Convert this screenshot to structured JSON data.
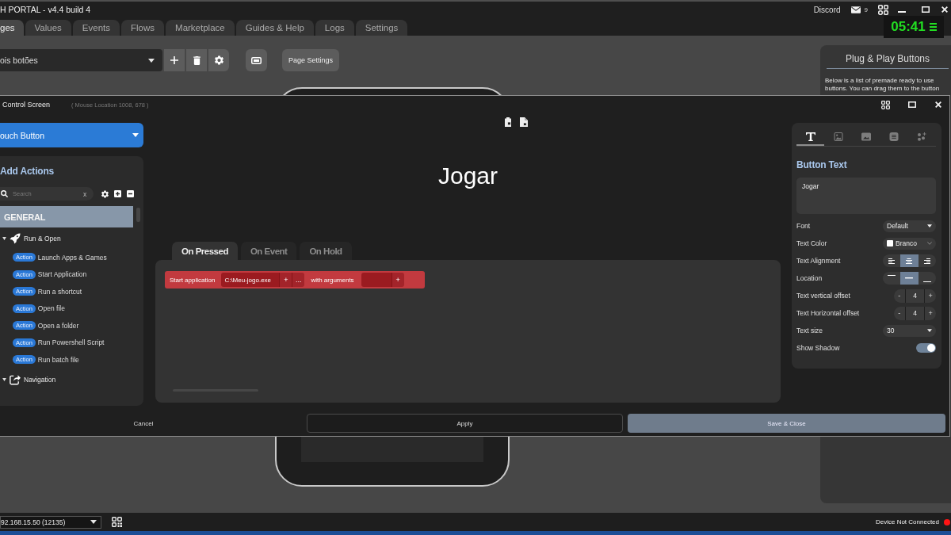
{
  "window": {
    "title": "H PORTAL - v4.4 build 4",
    "discord": "Discord",
    "mail_count": "9"
  },
  "clock": {
    "time": "05:41"
  },
  "tabs": [
    {
      "label": "ges",
      "selected": true
    },
    {
      "label": "Values",
      "selected": false
    },
    {
      "label": "Events",
      "selected": false
    },
    {
      "label": "Flows",
      "selected": false
    },
    {
      "label": "Marketplace",
      "selected": false
    },
    {
      "label": "Guides & Help",
      "selected": false
    },
    {
      "label": "Logs",
      "selected": false
    },
    {
      "label": "Settings",
      "selected": false
    }
  ],
  "toolbar": {
    "page": "ois botões",
    "page_settings": "Page Settings"
  },
  "plug_panel": {
    "title": "Plug & Play Buttons",
    "description": "Below is a list of premade ready to use buttons. You can drag them to the button"
  },
  "editor": {
    "title": "Control Screen",
    "mouse_location": "( Mouse Location 1008, 678 )",
    "control_type": "ouch Button",
    "actions_panel": {
      "title": "Add Actions",
      "search_placeholder": "Search",
      "clear": "x",
      "category": "GENERAL",
      "groups": [
        {
          "kind": "run",
          "label": "Run & Open",
          "expanded": true,
          "children": [
            {
              "badge": "Action",
              "label": "Launch Apps & Games"
            },
            {
              "badge": "Action",
              "label": "Start Application"
            },
            {
              "badge": "Action",
              "label": "Run a shortcut"
            },
            {
              "badge": "Action",
              "label": "Open file"
            },
            {
              "badge": "Action",
              "label": "Open a folder"
            },
            {
              "badge": "Action",
              "label": "Run Powershell Script"
            },
            {
              "badge": "Action",
              "label": "Run batch file"
            }
          ]
        },
        {
          "kind": "navigation",
          "label": "Navigation",
          "expanded": true
        }
      ]
    },
    "preview_text": "Jogar",
    "event_tabs": [
      {
        "label": "On Pressed",
        "selected": true
      },
      {
        "label": "On Event",
        "selected": false
      },
      {
        "label": "On Hold",
        "selected": false
      }
    ],
    "actions": [
      {
        "label": "Start application",
        "path": "C:\\Meu-jogo.exe",
        "add": "+",
        "browse": "...",
        "args_label": "with arguments",
        "args_add": "+"
      }
    ],
    "properties": {
      "tabs": [
        {
          "kind": "text",
          "selected": true
        },
        {
          "kind": "image",
          "selected": false
        },
        {
          "kind": "picture",
          "selected": false
        },
        {
          "kind": "list",
          "selected": false
        },
        {
          "kind": "effects",
          "selected": false
        }
      ],
      "heading": "Button Text",
      "text": "Jogar",
      "rows": [
        {
          "kind": "select",
          "label": "Font",
          "value": "Default"
        },
        {
          "kind": "color",
          "label": "Text Color",
          "value": "Branco",
          "color": "#ffffff"
        },
        {
          "kind": "segmented",
          "label": "Text Alignment",
          "options": [
            {
              "kind": "left",
              "selected": false
            },
            {
              "kind": "center",
              "selected": true
            },
            {
              "kind": "right",
              "selected": false
            }
          ]
        },
        {
          "kind": "segmented",
          "label": "Location",
          "options": [
            {
              "kind": "top",
              "selected": false
            },
            {
              "kind": "middle",
              "selected": true
            },
            {
              "kind": "bottom",
              "selected": false
            }
          ]
        },
        {
          "kind": "stepper",
          "label": "Text vertical offset",
          "minus": "-",
          "value": "4",
          "plus": "+"
        },
        {
          "kind": "stepper",
          "label": "Text Horizontal offset",
          "minus": "-",
          "value": "4",
          "plus": "+"
        },
        {
          "kind": "select",
          "label": "Text size",
          "value": "30"
        },
        {
          "kind": "toggle",
          "label": "Show Shadow",
          "on": true
        }
      ]
    },
    "footer": {
      "cancel": "Cancel",
      "apply": "Apply",
      "save": "Save & Close"
    }
  },
  "status_bar": {
    "connection": "92.168.15.50 (12135)",
    "device_status": "Device Not Connected",
    "connected": false
  }
}
